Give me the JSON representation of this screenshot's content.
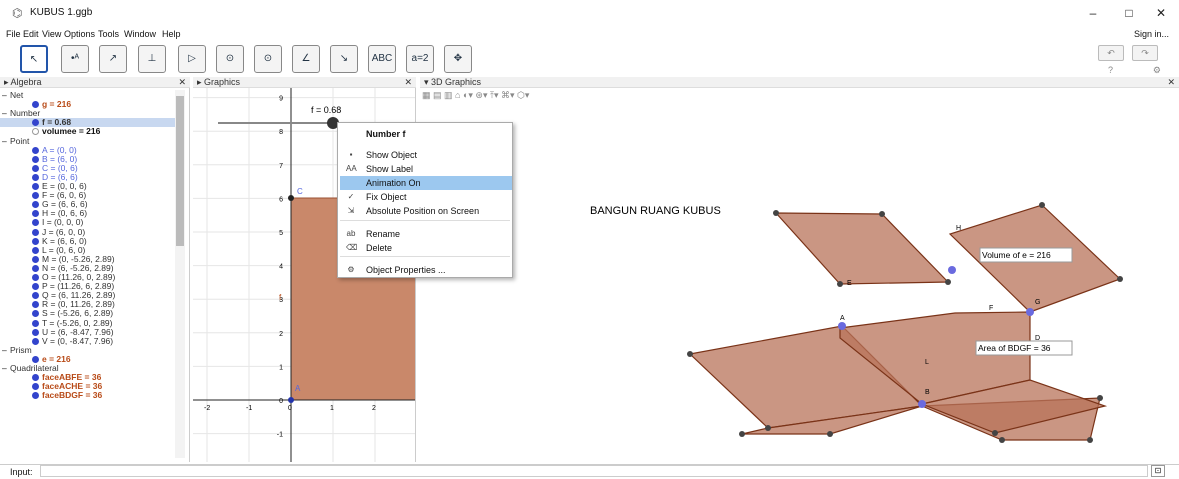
{
  "window": {
    "title": "KUBUS 1.ggb",
    "min": "–",
    "max": "□",
    "close": "✕"
  },
  "menu": {
    "items": [
      "File",
      "Edit",
      "View",
      "Options",
      "Tools",
      "Window",
      "Help"
    ],
    "signin": "Sign in..."
  },
  "toolbar": {
    "tools": [
      "↖",
      "•ᴬ",
      "↗",
      "⊥",
      "▷",
      "⊙",
      "⊙",
      "∠",
      "↘",
      "ABC",
      "a=2",
      "✥"
    ],
    "undo": "↶",
    "redo": "↷",
    "help": "?",
    "gear": "⚙"
  },
  "panels": {
    "algebra": "Algebra",
    "graphics": "Graphics",
    "g3d": "3D Graphics"
  },
  "algebra": {
    "rows": [
      {
        "type": "group",
        "text": "Net"
      },
      {
        "type": "item",
        "text": "g = 216",
        "color": "#b84a17",
        "bold": true
      },
      {
        "type": "group",
        "text": "Number"
      },
      {
        "type": "item",
        "text": "f = 0.68",
        "color": "#333333",
        "bold": true,
        "selected": true
      },
      {
        "type": "item",
        "text": "volumee = 216",
        "color": "#111111",
        "bold": true,
        "hollow": true
      },
      {
        "type": "group",
        "text": "Point"
      },
      {
        "type": "item",
        "text": "A = (0, 0)",
        "color": "#5566dd"
      },
      {
        "type": "item",
        "text": "B = (6, 0)",
        "color": "#5566dd"
      },
      {
        "type": "item",
        "text": "C = (0, 6)",
        "color": "#5566dd"
      },
      {
        "type": "item",
        "text": "D = (6, 6)",
        "color": "#5566dd"
      },
      {
        "type": "item",
        "text": "E = (0, 0, 6)",
        "color": "#333333"
      },
      {
        "type": "item",
        "text": "F = (6, 0, 6)",
        "color": "#333333"
      },
      {
        "type": "item",
        "text": "G = (6, 6, 6)",
        "color": "#333333"
      },
      {
        "type": "item",
        "text": "H = (0, 6, 6)",
        "color": "#333333"
      },
      {
        "type": "item",
        "text": "I = (0, 0, 0)",
        "color": "#333333"
      },
      {
        "type": "item",
        "text": "J = (6, 0, 0)",
        "color": "#333333"
      },
      {
        "type": "item",
        "text": "K = (6, 6, 0)",
        "color": "#333333"
      },
      {
        "type": "item",
        "text": "L = (0, 6, 0)",
        "color": "#333333"
      },
      {
        "type": "item",
        "text": "M = (0, -5.26, 2.89)",
        "color": "#333333"
      },
      {
        "type": "item",
        "text": "N = (6, -5.26, 2.89)",
        "color": "#333333"
      },
      {
        "type": "item",
        "text": "O = (11.26, 0, 2.89)",
        "color": "#333333"
      },
      {
        "type": "item",
        "text": "P = (11.26, 6, 2.89)",
        "color": "#333333"
      },
      {
        "type": "item",
        "text": "Q = (6, 11.26, 2.89)",
        "color": "#333333"
      },
      {
        "type": "item",
        "text": "R = (0, 11.26, 2.89)",
        "color": "#333333"
      },
      {
        "type": "item",
        "text": "S = (-5.26, 6, 2.89)",
        "color": "#333333"
      },
      {
        "type": "item",
        "text": "T = (-5.26, 0, 2.89)",
        "color": "#333333"
      },
      {
        "type": "item",
        "text": "U = (6, -8.47, 7.96)",
        "color": "#333333"
      },
      {
        "type": "item",
        "text": "V = (0, -8.47, 7.96)",
        "color": "#333333"
      },
      {
        "type": "group",
        "text": "Prism"
      },
      {
        "type": "item",
        "text": "e = 216",
        "color": "#b84a17",
        "bold": true
      },
      {
        "type": "group",
        "text": "Quadrilateral"
      },
      {
        "type": "item",
        "text": "faceABFE = 36",
        "color": "#b84a17",
        "bold": true
      },
      {
        "type": "item",
        "text": "faceACHE = 36",
        "color": "#b84a17",
        "bold": true
      },
      {
        "type": "item",
        "text": "faceBDGF = 36",
        "color": "#b84a17",
        "bold": true
      }
    ]
  },
  "graphics": {
    "slider_label": "f = 0.68",
    "yticks": [
      "9",
      "8",
      "7",
      "6",
      "5",
      "4",
      "3",
      "2",
      "1",
      "0",
      "-1"
    ],
    "xticks": [
      "-2",
      "-1",
      "0",
      "1",
      "2"
    ],
    "point_c": "C",
    "point_a": "A",
    "label_f": "f"
  },
  "context_menu": {
    "title": "Number f",
    "items": [
      {
        "icon": "▪",
        "label": "Show Object",
        "hl": false
      },
      {
        "icon": "AA",
        "label": "Show Label",
        "hl": false
      },
      {
        "icon": "",
        "label": "Animation On",
        "hl": true
      },
      {
        "icon": "✓",
        "label": "Fix Object",
        "hl": false
      },
      {
        "icon": "⇲",
        "label": "Absolute Position on Screen",
        "hl": false
      },
      {
        "icon": "ab",
        "label": "Rename",
        "hl": false
      },
      {
        "icon": "⌫",
        "label": "Delete",
        "hl": false
      },
      {
        "icon": "⚙",
        "label": "Object Properties ...",
        "hl": false
      }
    ]
  },
  "g3d": {
    "heading": "BANGUN RUANG KUBUS",
    "volume_label": "Volume of e = 216",
    "area_label": "Area of  BDGF = 36",
    "points": {
      "H": "H",
      "E": "E",
      "G": "G",
      "F": "F",
      "A": "A",
      "B": "B",
      "D": "D",
      "L": "L"
    }
  },
  "input": {
    "label": "Input:",
    "btn": "⊡"
  },
  "colors": {
    "face": "#b8735a",
    "edge": "#8a3a1a",
    "accent": "#2255aa",
    "highlight": "#9cc8ef"
  }
}
